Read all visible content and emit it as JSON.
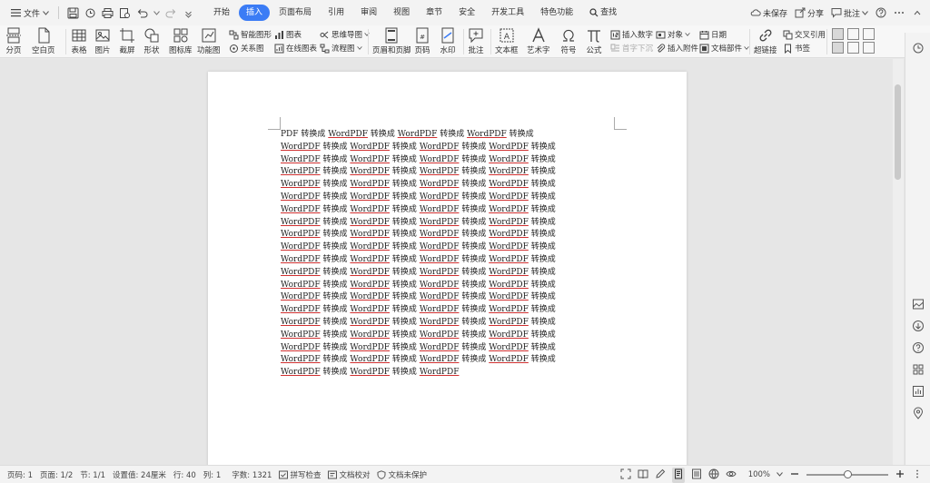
{
  "menubar": {
    "file_label": "文件",
    "tabs": [
      {
        "label": "开始",
        "active": false
      },
      {
        "label": "插入",
        "active": true
      },
      {
        "label": "页面布局",
        "active": false
      },
      {
        "label": "引用",
        "active": false
      },
      {
        "label": "审阅",
        "active": false
      },
      {
        "label": "视图",
        "active": false
      },
      {
        "label": "章节",
        "active": false
      },
      {
        "label": "安全",
        "active": false
      },
      {
        "label": "开发工具",
        "active": false
      },
      {
        "label": "特色功能",
        "active": false
      }
    ],
    "search_label": "查找",
    "unsaved_label": "未保存",
    "share_label": "分享",
    "comment_label": "批注"
  },
  "ribbon": {
    "page_break": "分页",
    "blank_page": "空白页",
    "table": "表格",
    "picture": "图片",
    "screenshot": "截屏",
    "shape": "形状",
    "icon_library": "图标库",
    "function_chart": "功能图",
    "smart_art": "智能图形",
    "relation_chart": "关系图",
    "chart": "图表",
    "online_chart": "在线图表",
    "mind_map": "思维导图",
    "flowchart": "流程图",
    "header_footer": "页眉和页脚",
    "page_number": "页码",
    "watermark": "水印",
    "comment": "批注",
    "text_box": "文本框",
    "art_text": "艺术字",
    "symbol": "符号",
    "formula": "公式",
    "insert_number": "插入数字",
    "drop_cap": "首字下沉",
    "object": "对象",
    "insert_attachment": "插入附件",
    "date": "日期",
    "doc_parts": "文档部件",
    "hyperlink": "超链接",
    "cross_ref": "交叉引用",
    "bookmark": "书签"
  },
  "document": {
    "lead": "PDF",
    "word": "WordPDF",
    "verb": "转换成"
  },
  "statusbar": {
    "page_num": "页码: 1",
    "pages": "页面: 1/2",
    "section": "节: 1/1",
    "setting": "设置值: 24厘米",
    "row": "行: 40",
    "col": "列: 1",
    "word_count": "字数: 1321",
    "spell_check": "拼写检查",
    "doc_proof": "文档校对",
    "doc_protect": "文档未保护",
    "zoom": "100%",
    "zoom_fraction": 0.5
  }
}
